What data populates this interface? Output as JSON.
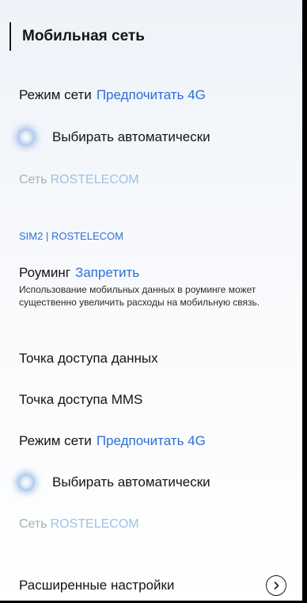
{
  "header": {
    "title": "Мобильная сеть"
  },
  "sim1": {
    "network_mode_label": "Режим сети",
    "network_mode_value": "Предпочитать 4G",
    "auto_select_label": "Выбирать автоматически",
    "network_label": "Сеть",
    "network_value": "ROSTELECOM"
  },
  "sim2": {
    "section_title": "SIM2 | ROSTELECOM",
    "roaming_label": "Роуминг",
    "roaming_value": "Запретить",
    "roaming_description": "Использование мобильных данных в роуминге может существенно увеличить расходы на мобильную связь.",
    "apn_label": "Точка доступа данных",
    "mms_apn_label": "Точка доступа MMS",
    "network_mode_label": "Режим сети",
    "network_mode_value": "Предпочитать 4G",
    "auto_select_label": "Выбирать автоматически",
    "network_label": "Сеть",
    "network_value": "ROSTELECOM"
  },
  "advanced": {
    "label": "Расширенные настройки"
  },
  "icons": {
    "advanced_arrow": "chevron-right-icon"
  },
  "colors": {
    "accent": "#2f6fd6",
    "muted": "#a7aeb6",
    "muted_accent": "#9cc2e8"
  }
}
